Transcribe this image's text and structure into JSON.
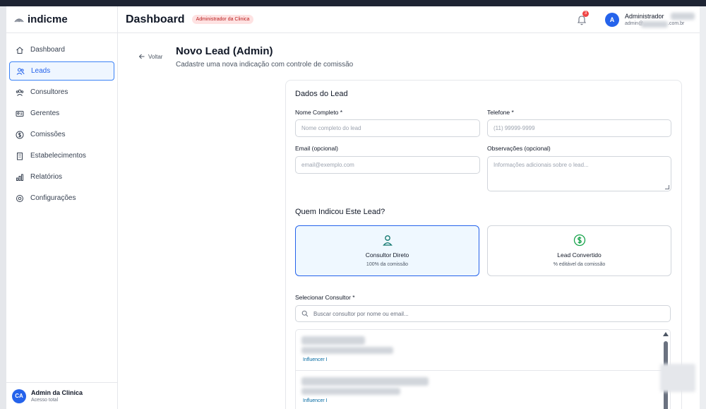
{
  "brand": {
    "name": "indicme",
    "icon": "wifi-waves-icon"
  },
  "sidebar": {
    "items": [
      {
        "label": "Dashboard",
        "icon": "home-icon",
        "active": false
      },
      {
        "label": "Leads",
        "icon": "users-icon",
        "active": true
      },
      {
        "label": "Consultores",
        "icon": "user-group-icon",
        "active": false
      },
      {
        "label": "Gerentes",
        "icon": "id-card-icon",
        "active": false
      },
      {
        "label": "Comissões",
        "icon": "dollar-circle-icon",
        "active": false
      },
      {
        "label": "Estabelecimentos",
        "icon": "building-icon",
        "active": false
      },
      {
        "label": "Relatórios",
        "icon": "bar-chart-icon",
        "active": false
      },
      {
        "label": "Configurações",
        "icon": "gear-icon",
        "active": false
      }
    ],
    "footer": {
      "initials": "CA",
      "name": "Admin da Clinica",
      "subtitle": "Acesso total"
    }
  },
  "header": {
    "title": "Dashboard",
    "role_badge": "Administrador da Clinica",
    "notification_count": "3",
    "user_initial": "A",
    "user_name": "Administrador",
    "user_email_start": "admin@",
    "user_email_end": ".com.br"
  },
  "page": {
    "back_label": "Voltar",
    "title": "Novo Lead (Admin)",
    "subtitle": "Cadastre uma nova indicação com controle de comissão"
  },
  "form": {
    "section_title": "Dados do Lead",
    "name_label": "Nome Completo *",
    "name_placeholder": "Nome completo do lead",
    "phone_label": "Telefone *",
    "phone_placeholder": "(11) 99999-9999",
    "email_label": "Email (opcional)",
    "email_placeholder": "email@exemplo.com",
    "notes_label": "Observações (opcional)",
    "notes_placeholder": "Informações adicionais sobre o lead...",
    "referral_title": "Quem Indicou Este Lead?",
    "choices": [
      {
        "title": "Consultor Direto",
        "subtitle": "100% da comissão",
        "selected": true,
        "icon": "user-icon"
      },
      {
        "title": "Lead Convertido",
        "subtitle": "% editável da comissão",
        "selected": false,
        "icon": "dollar-circle-icon"
      }
    ],
    "consultant_label": "Selecionar Consultor *",
    "search_placeholder": "Buscar consultor por nome ou email...",
    "consultants": [
      {
        "tier": "Influencer I"
      },
      {
        "tier": "Influencer I"
      }
    ]
  },
  "colors": {
    "accent": "#2563eb",
    "badge_text": "#b91c1c",
    "badge_bg": "#fee2e2",
    "convert_icon": "#16a34a"
  }
}
